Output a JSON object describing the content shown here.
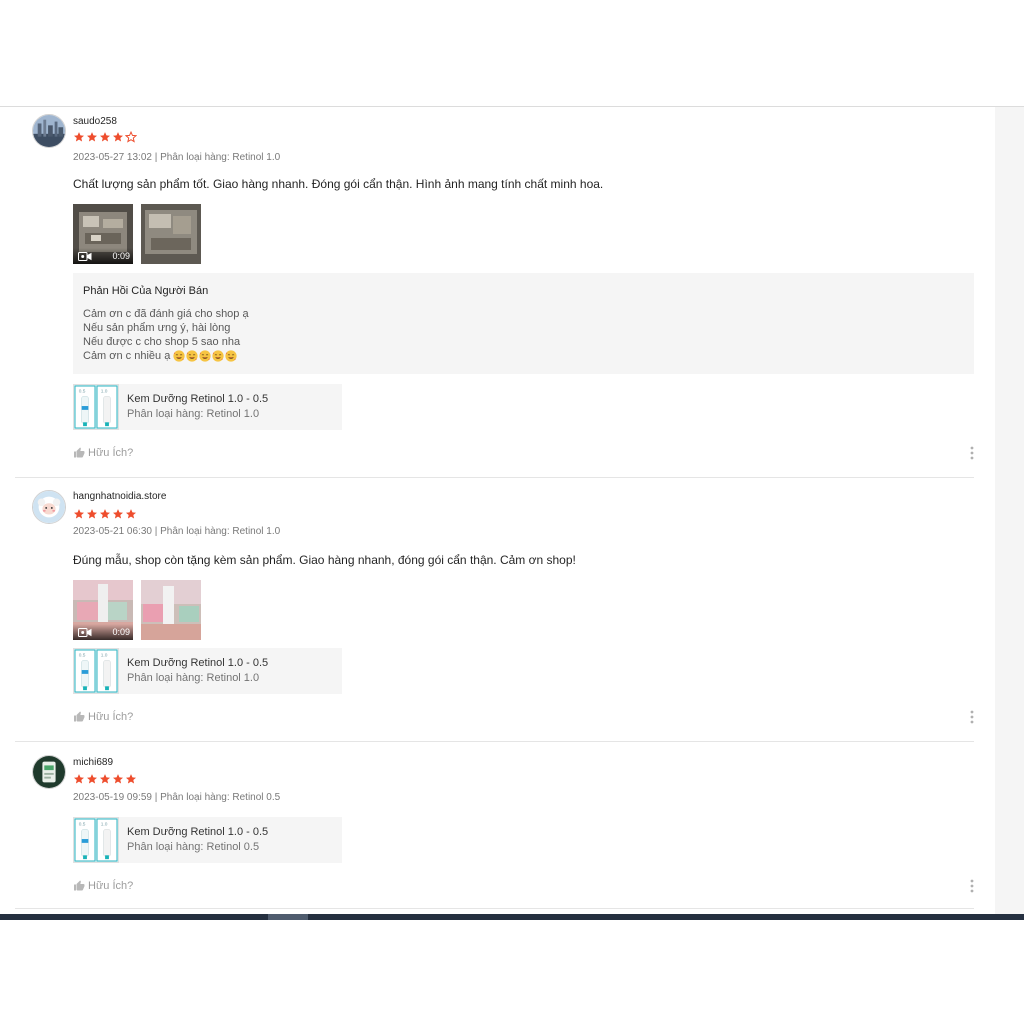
{
  "colors": {
    "star": "#ee4d2d",
    "text": "#222222",
    "muted": "#8a8a8a",
    "panel": "#f5f5f5",
    "accent": "#18aeb5"
  },
  "reviews": [
    {
      "username": "saudo258",
      "rating": 4,
      "max_rating": 5,
      "meta": "2023-05-27 13:02 | Phân loại hàng: Retinol 1.0",
      "comment": "Chất lượng sản phẩm tốt. Giao hàng nhanh. Đóng gói cẩn thận. Hình ảnh mang tính chất minh hoa.",
      "media": [
        {
          "type": "video",
          "duration": "0:09"
        },
        {
          "type": "image"
        }
      ],
      "seller_reply": {
        "title": "Phản Hồi Của Người Bán",
        "lines": [
          "Cảm ơn c đã đánh giá cho shop ạ",
          "Nếu sản phẩm ưng ý, hài lòng",
          "Nếu được c cho shop 5 sao nha",
          "Cảm ơn c nhiều ạ"
        ],
        "emoji": "smiling-face-with-hearts",
        "emoji_count": 5
      },
      "product": {
        "name": "Kem Dưỡng Retinol 1.0 - 0.5",
        "variant": "Phân loại hàng: Retinol 1.0"
      },
      "helpful_label": "Hữu Ích?"
    },
    {
      "username": "hangnhatnoidia.store",
      "rating": 5,
      "max_rating": 5,
      "meta": "2023-05-21 06:30 | Phân loại hàng: Retinol 1.0",
      "comment": "Đúng mẫu, shop còn tặng kèm sản phẩm. Giao hàng nhanh, đóng gói cẩn thận. Cảm ơn shop!",
      "media": [
        {
          "type": "video",
          "duration": "0:09"
        },
        {
          "type": "image"
        }
      ],
      "product": {
        "name": "Kem Dưỡng Retinol 1.0 - 0.5",
        "variant": "Phân loại hàng: Retinol 1.0"
      },
      "helpful_label": "Hữu Ích?"
    },
    {
      "username": "michi689",
      "rating": 5,
      "max_rating": 5,
      "meta": "2023-05-19 09:59 | Phân loại hàng: Retinol 0.5",
      "product": {
        "name": "Kem Dưỡng Retinol 1.0 - 0.5",
        "variant": "Phân loại hàng: Retinol 0.5"
      },
      "helpful_label": "Hữu Ích?"
    }
  ],
  "icons": {
    "star": "star-icon",
    "video": "video-camera-icon",
    "helpful": "thumbs-up-icon",
    "more": "more-vertical-icon"
  }
}
